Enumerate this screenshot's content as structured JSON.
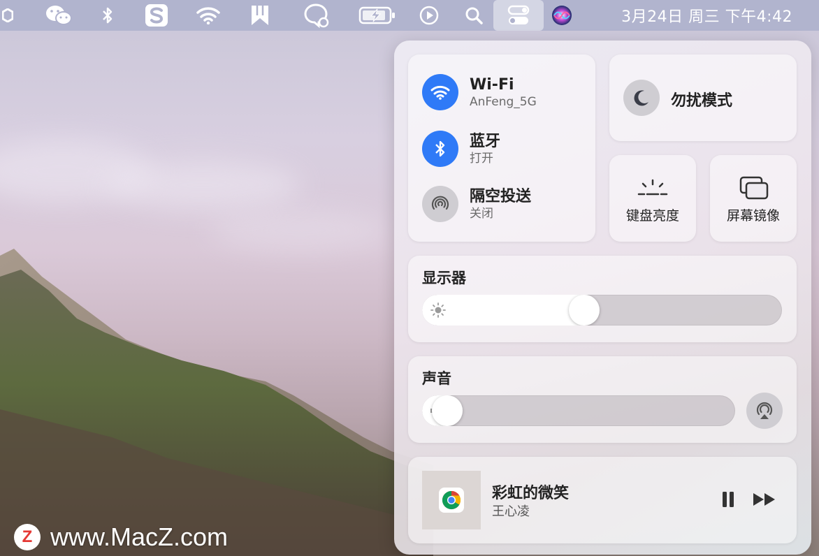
{
  "menubar": {
    "clock": "3月24日 周三 下午4:42",
    "icons": [
      "app-icon",
      "wechat-icon",
      "bluetooth-icon",
      "sogou-input-icon",
      "wifi-icon",
      "bookmark-icon",
      "chat-bubble-icon",
      "battery-charging-icon",
      "play-icon",
      "search-icon",
      "control-center-icon",
      "siri-icon"
    ]
  },
  "control_center": {
    "wifi": {
      "title": "Wi-Fi",
      "subtitle": "AnFeng_5G",
      "state": "on"
    },
    "bluetooth": {
      "title": "蓝牙",
      "subtitle": "打开",
      "state": "on"
    },
    "airdrop": {
      "title": "隔空投送",
      "subtitle": "关闭",
      "state": "off"
    },
    "do_not_disturb": {
      "label": "勿扰模式"
    },
    "keyboard_brightness": {
      "label": "键盘亮度"
    },
    "screen_mirroring": {
      "label": "屏幕镜像"
    },
    "display": {
      "title": "显示器",
      "brightness": 0.45
    },
    "sound": {
      "title": "声音",
      "volume": 0.08
    },
    "now_playing": {
      "title": "彩虹的微笑",
      "artist": "王心凌"
    }
  },
  "colors": {
    "accent": "#2f7af7",
    "menubar": "#afb2cd"
  },
  "watermark": {
    "logo": "Z",
    "text": "www.MacZ.com"
  }
}
